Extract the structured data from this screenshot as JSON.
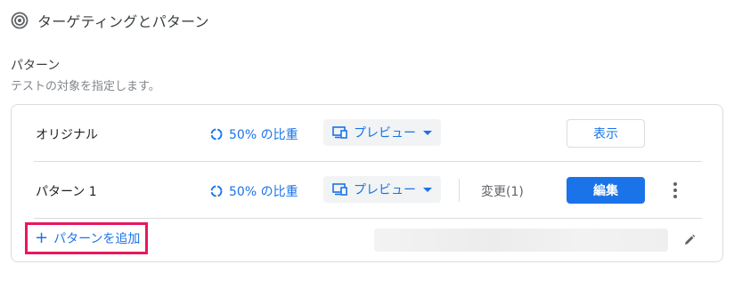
{
  "header": {
    "title": "ターゲティングとパターン",
    "icon": "target-icon"
  },
  "section": {
    "title": "パターン",
    "subtitle": "テストの対象を指定します。"
  },
  "variants": [
    {
      "name": "オリジナル",
      "weight": "50% の比重",
      "preview_label": "プレビュー",
      "action_label": "表示"
    },
    {
      "name": "パターン 1",
      "weight": "50% の比重",
      "preview_label": "プレビュー",
      "changes": "変更(1)",
      "action_label": "編集"
    }
  ],
  "add_variant": {
    "label": "パターンを追加"
  },
  "colors": {
    "accent": "#1a73e8",
    "highlight": "#e8175d",
    "border": "#dadce0"
  }
}
